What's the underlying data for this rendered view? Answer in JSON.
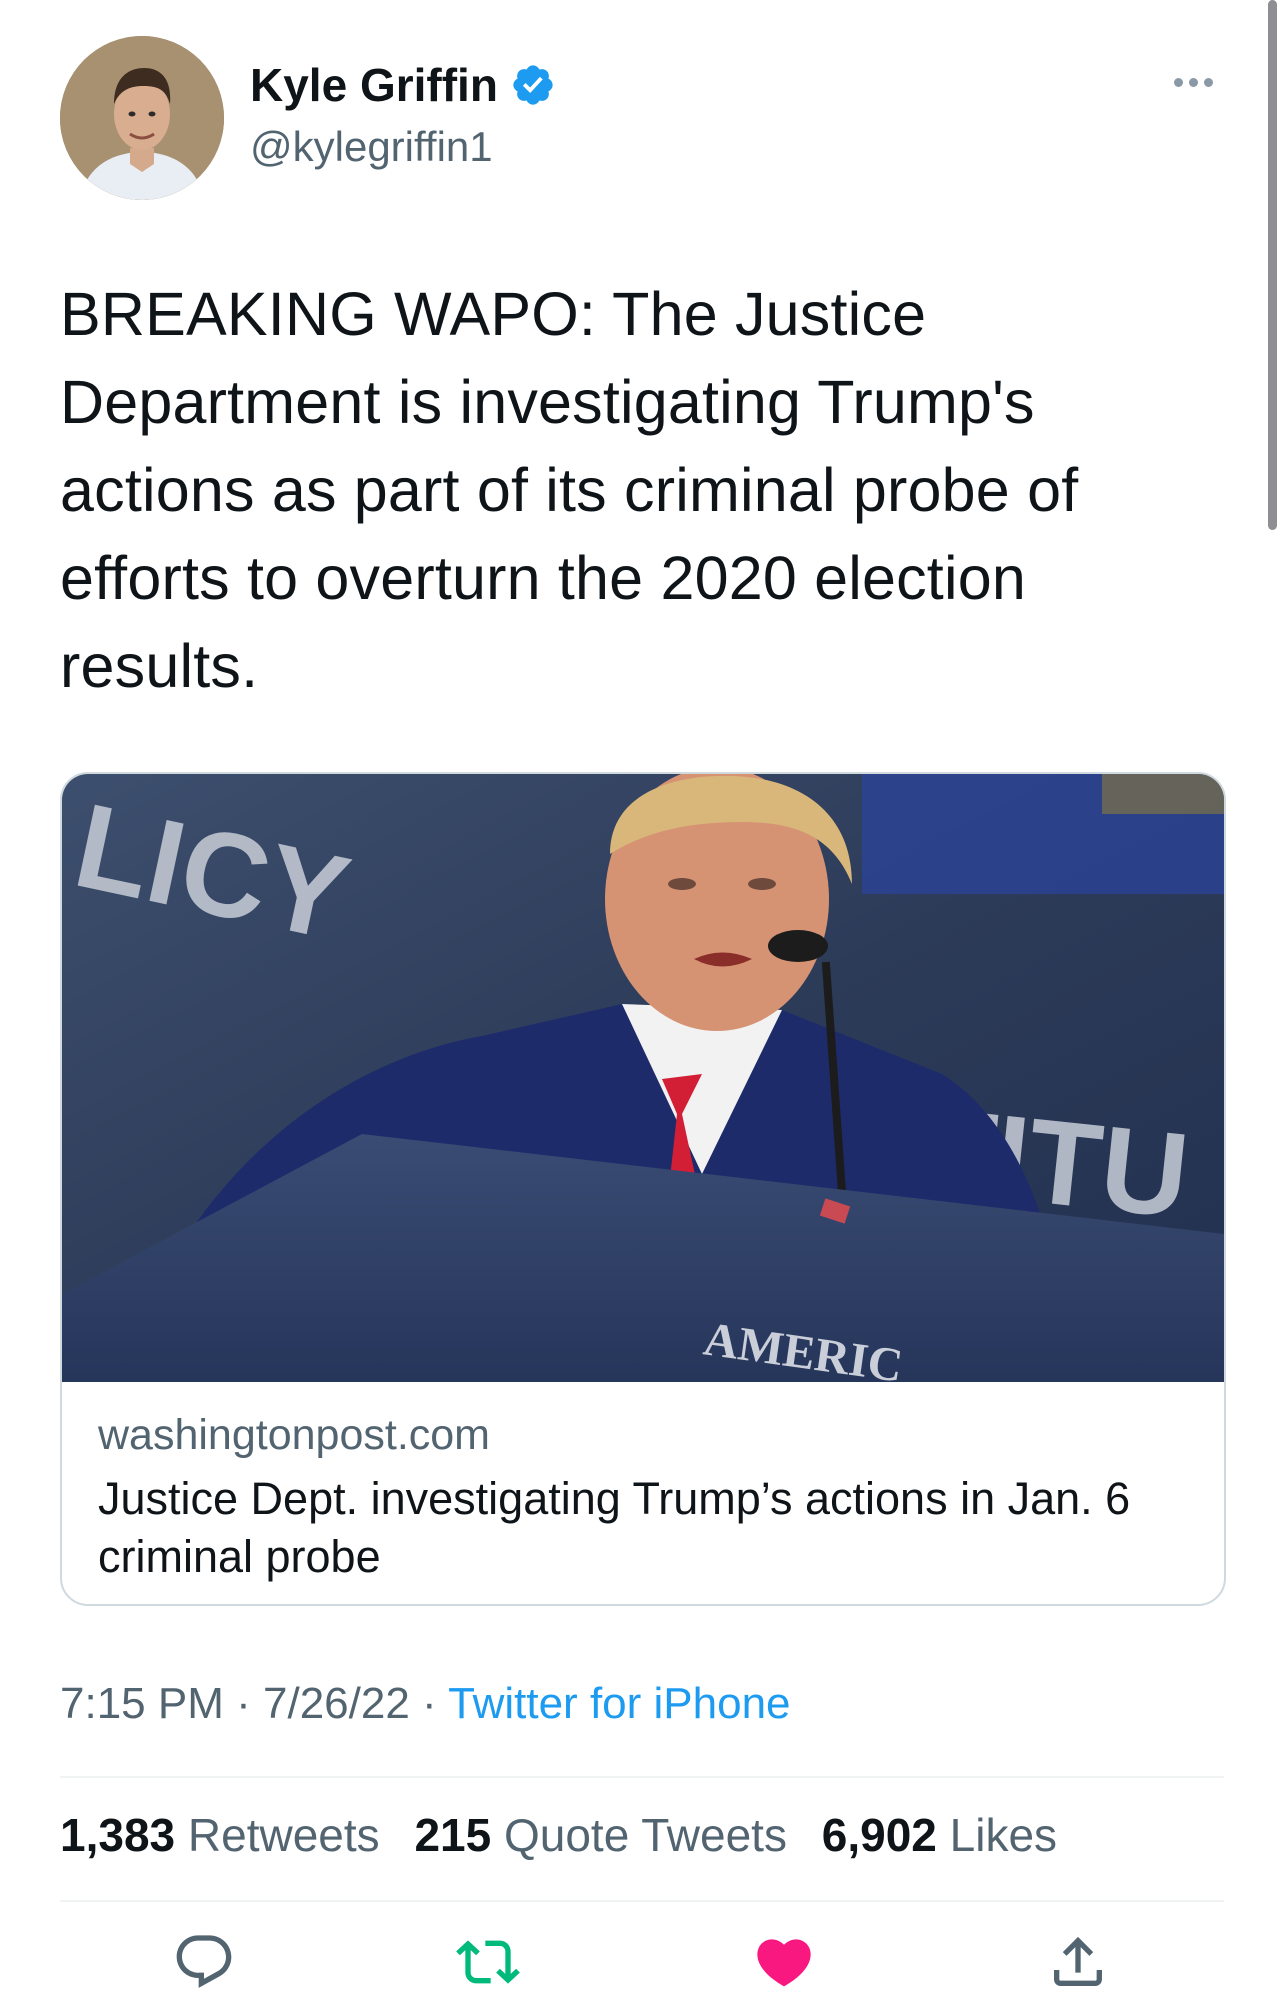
{
  "author": {
    "display_name": "Kyle Griffin",
    "handle": "@kylegriffin1",
    "verified": true,
    "verified_color": "#1d9bf0"
  },
  "tweet": {
    "text": "BREAKING WAPO: The Justice Department is investigating Trump's actions as part of its criminal probe of efforts to overturn the 2020 election results."
  },
  "link_card": {
    "image_description": "photo-of-speaker-at-podium",
    "image_text": [
      "LICY",
      "STITU",
      "AMERIC"
    ],
    "domain": "washingtonpost.com",
    "title": "Justice Dept. investigating Trump’s actions in Jan. 6 criminal probe"
  },
  "meta": {
    "time": "7:15 PM",
    "separator": "·",
    "date": "7/26/22",
    "source": "Twitter for iPhone",
    "source_color": "#1d9bf0"
  },
  "stats": {
    "retweets_count": "1,383",
    "retweets_label": "Retweets",
    "quotes_count": "215",
    "quotes_label": "Quote Tweets",
    "likes_count": "6,902",
    "likes_label": "Likes"
  },
  "actions": {
    "reply_icon": "reply-icon",
    "retweet_icon": "retweet-icon",
    "retweet_color": "#00ba7c",
    "like_icon": "heart-filled-icon",
    "like_color": "#f91880",
    "share_icon": "share-icon"
  }
}
